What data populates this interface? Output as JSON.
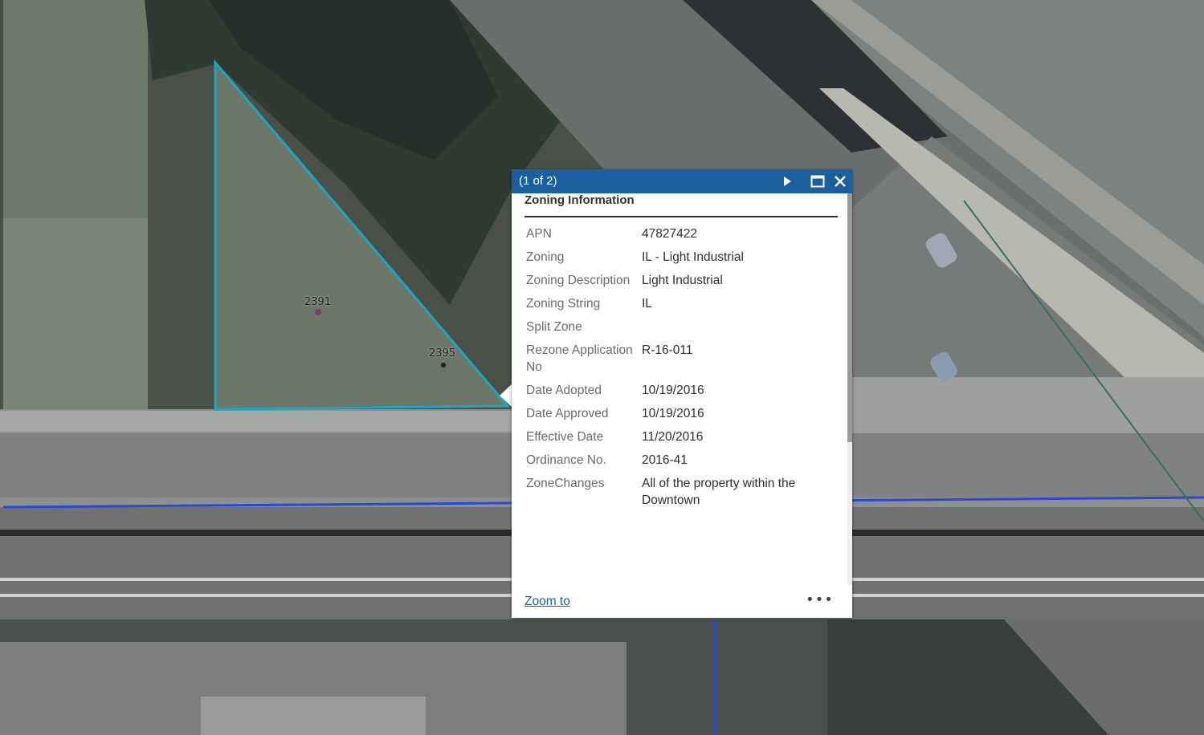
{
  "map": {
    "parcel_labels": [
      "2391",
      "2395"
    ],
    "colors": {
      "parcel_outline": "#1aa7c4",
      "road_line": "#2a48d8",
      "header_bg": "#1b5f9f"
    }
  },
  "popup": {
    "pager": "(1 of 2)",
    "title": "Zoning Information",
    "icons": {
      "next": "play-next-icon",
      "maximize": "maximize-icon",
      "close": "close-icon",
      "more": "more-dots-icon"
    },
    "attributes": [
      {
        "key": "APN",
        "value": "47827422"
      },
      {
        "key": "Zoning",
        "value": "IL - Light Industrial"
      },
      {
        "key": "Zoning Description",
        "value": "Light Industrial"
      },
      {
        "key": "Zoning String",
        "value": "IL"
      },
      {
        "key": "Split Zone",
        "value": ""
      },
      {
        "key": "Rezone Application No",
        "value": "R-16-011"
      },
      {
        "key": "Date Adopted",
        "value": "10/19/2016"
      },
      {
        "key": "Date Approved",
        "value": "10/19/2016"
      },
      {
        "key": "Effective Date",
        "value": "11/20/2016"
      },
      {
        "key": "Ordinance No.",
        "value": "2016-41"
      },
      {
        "key": "ZoneChanges",
        "value": "All of the property within the Downtown"
      }
    ],
    "zoom_label": "Zoom to",
    "more_label": "•••"
  }
}
